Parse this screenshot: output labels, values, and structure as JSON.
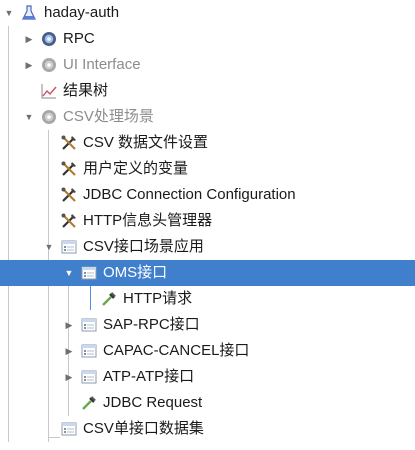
{
  "tree": {
    "root": {
      "label": "haday-auth",
      "icon": "flask-icon"
    },
    "items": [
      {
        "label": "RPC",
        "icon": "gear-icon"
      },
      {
        "label": "UI Interface",
        "icon": "gear-icon"
      },
      {
        "label": "结果树",
        "icon": "graph-icon"
      },
      {
        "label": "CSV处理场景",
        "icon": "gear-icon"
      },
      {
        "label": "CSV 数据文件设置",
        "icon": "tools-icon"
      },
      {
        "label": "用户定义的变量",
        "icon": "tools-icon"
      },
      {
        "label": "JDBC Connection Configuration",
        "icon": "tools-icon"
      },
      {
        "label": "HTTP信息头管理器",
        "icon": "tools-icon"
      },
      {
        "label": "CSV接口场景应用",
        "icon": "controller-icon"
      },
      {
        "label": "OMS接口",
        "icon": "controller-icon"
      },
      {
        "label": "HTTP请求",
        "icon": "pipette-icon"
      },
      {
        "label": "SAP-RPC接口",
        "icon": "controller-icon"
      },
      {
        "label": "CAPAC-CANCEL接口",
        "icon": "controller-icon"
      },
      {
        "label": "ATP-ATP接口",
        "icon": "controller-icon"
      },
      {
        "label": "JDBC Request",
        "icon": "pipette-icon"
      },
      {
        "label": "CSV单接口数据集",
        "icon": "controller-icon"
      }
    ]
  },
  "colors": {
    "selection": "#3f7fcb",
    "disabled_text": "#8c8c8c"
  }
}
